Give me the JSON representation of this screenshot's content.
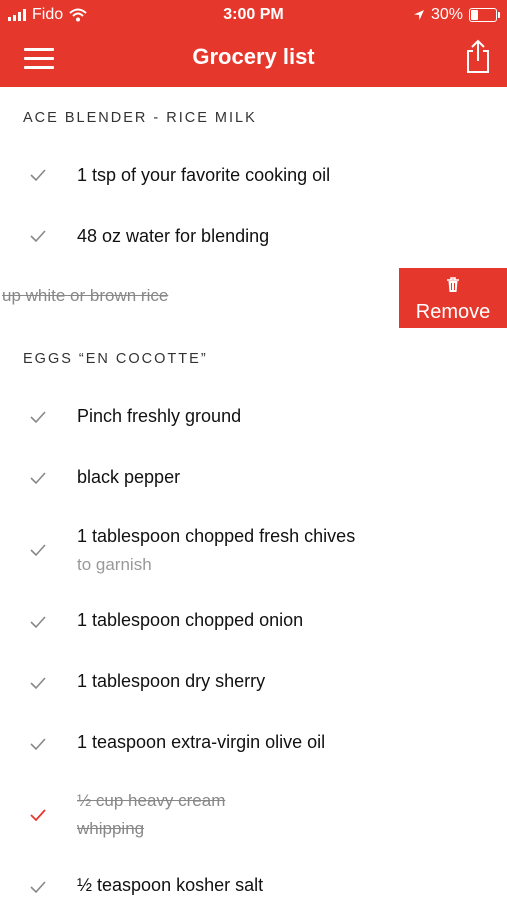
{
  "status": {
    "carrier": "Fido",
    "time": "3:00 PM",
    "battery": "30%"
  },
  "header": {
    "title": "Grocery list"
  },
  "sections": [
    {
      "title": "ACE BLENDER - RICE MILK",
      "items": [
        {
          "label": "1 tsp of your favorite cooking oil"
        },
        {
          "label": "48 oz water for blending"
        },
        {
          "label": "up white or brown rice",
          "swipe_action": "Remove"
        }
      ]
    },
    {
      "title": "EGGS “EN COCOTTE”",
      "items": [
        {
          "label": "Pinch freshly ground"
        },
        {
          "label": "black pepper"
        },
        {
          "label": "1 tablespoon chopped fresh chives",
          "note": "to garnish"
        },
        {
          "label": "1 tablespoon chopped onion"
        },
        {
          "label": "1 tablespoon dry sherry"
        },
        {
          "label": "1 teaspoon extra-virgin olive oil"
        },
        {
          "label": "½ cup heavy cream",
          "note": "whipping"
        },
        {
          "label": "½ teaspoon kosher salt"
        }
      ]
    }
  ],
  "colors": {
    "accent": "#e6372c",
    "check": "#888888",
    "check_active": "#e6372c"
  }
}
